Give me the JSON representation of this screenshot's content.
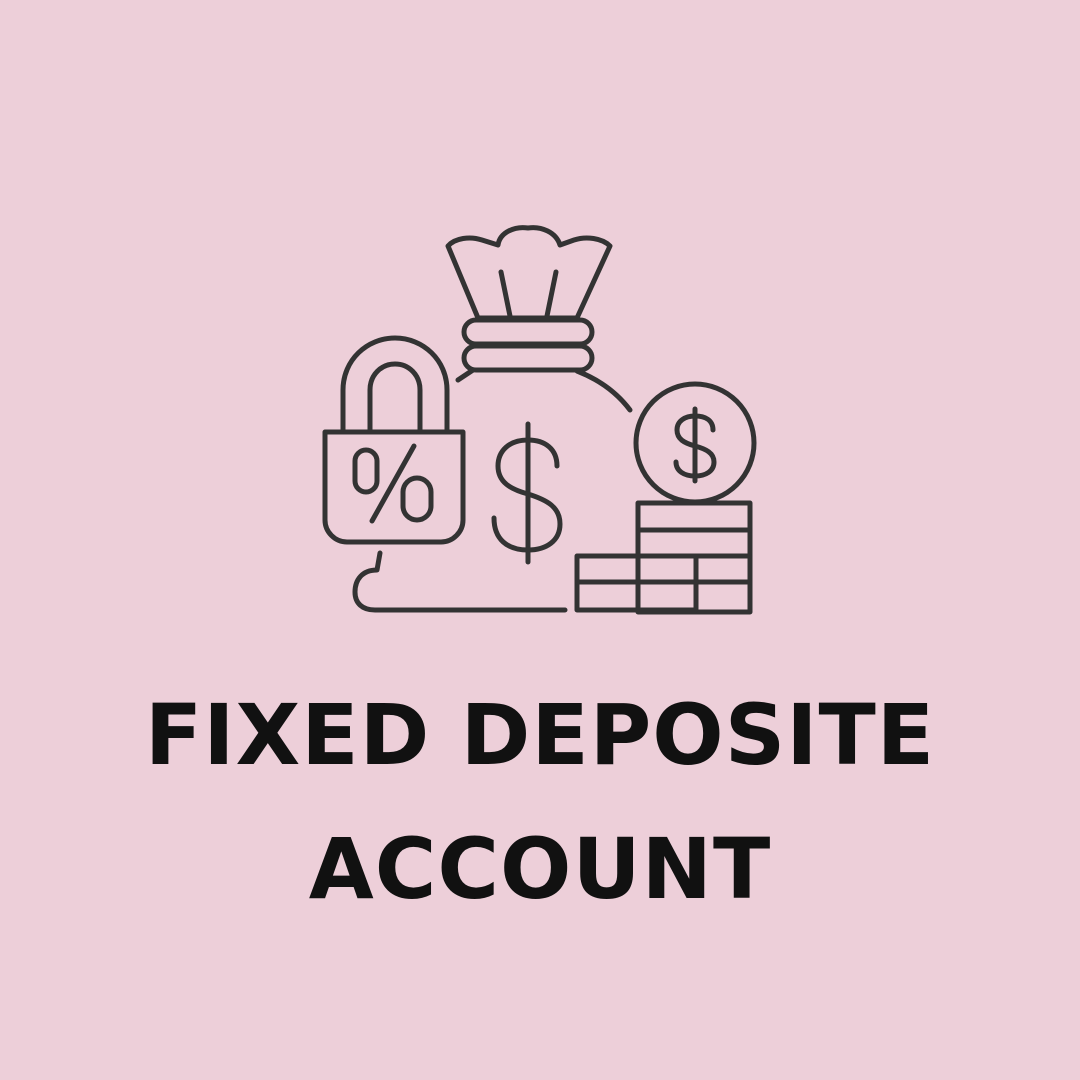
{
  "colors": {
    "background": "#EDCFD9",
    "icon_stroke": "#333333",
    "text": "#111111"
  },
  "icons": [
    "money-bag-icon",
    "padlock-percent-icon",
    "coin-stack-icon"
  ],
  "title": {
    "line1": "FIXED DEPOSITE",
    "line2": "ACCOUNT"
  }
}
